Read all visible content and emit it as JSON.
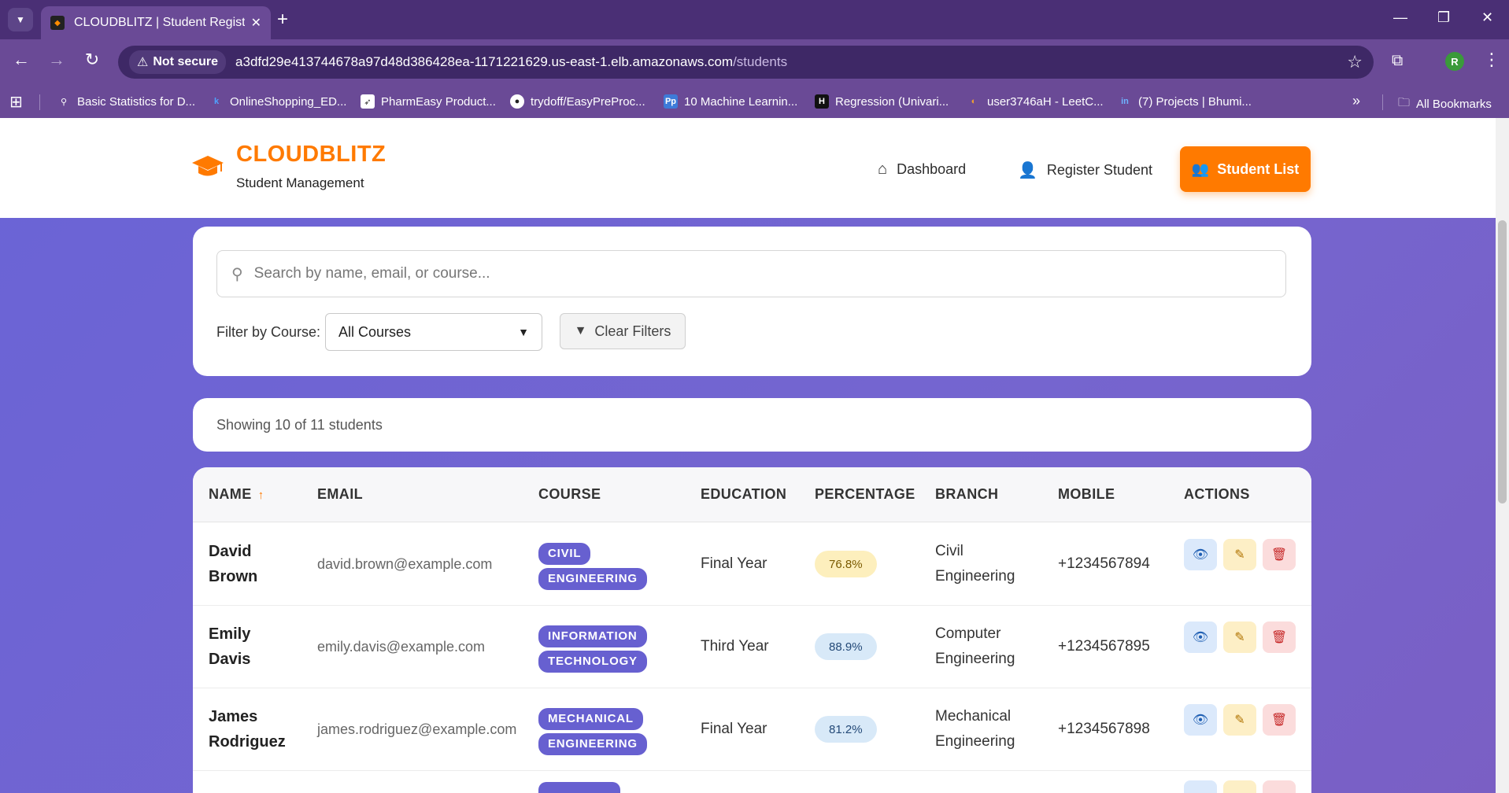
{
  "browser": {
    "tab_title": "CLOUDBLITZ | Student Registrat",
    "omnibox": {
      "security_label": "Not secure",
      "url_host": "a3dfd29e413744678a97d48d386428ea-1171221629.us-east-1.elb.amazonaws.com",
      "url_path": "/students"
    },
    "profile_initial": "R",
    "bookmarks": [
      "Basic Statistics for D...",
      "OnlineShopping_ED...",
      "PharmEasy Product...",
      "trydoff/EasyPreProc...",
      "10 Machine Learnin...",
      "Regression (Univari...",
      "user3746aH - LeetC...",
      "(7) Projects | Bhumi..."
    ],
    "all_bookmarks": "All Bookmarks"
  },
  "header": {
    "brand": "CLOUDBLITZ",
    "subtitle": "Student Management",
    "nav": {
      "dashboard": "Dashboard",
      "register": "Register Student",
      "list": "Student List"
    }
  },
  "filters": {
    "search_placeholder": "Search by name, email, or course...",
    "course_label": "Filter by Course:",
    "course_selected": "All Courses",
    "clear_label": "Clear Filters"
  },
  "summary": "Showing 10 of 11 students",
  "table": {
    "columns": [
      "NAME",
      "EMAIL",
      "COURSE",
      "EDUCATION",
      "PERCENTAGE",
      "BRANCH",
      "MOBILE",
      "ACTIONS"
    ],
    "sort_indicator": "↑",
    "rows": [
      {
        "name_first": "David",
        "name_last": "Brown",
        "email": "david.brown@example.com",
        "course_line1": "CIVIL",
        "course_line2": "ENGINEERING",
        "education": "Final Year",
        "percentage": "76.8%",
        "percentage_color": "#fdefbd",
        "branch_line1": "Civil",
        "branch_line2": "Engineering",
        "mobile": "+1234567894"
      },
      {
        "name_first": "Emily",
        "name_last": "Davis",
        "email": "emily.davis@example.com",
        "course_line1": "INFORMATION",
        "course_line2": "TECHNOLOGY",
        "education": "Third Year",
        "percentage": "88.9%",
        "percentage_color": "#d8e9f8",
        "branch_line1": "Computer",
        "branch_line2": "Engineering",
        "mobile": "+1234567895"
      },
      {
        "name_first": "James",
        "name_last": "Rodriguez",
        "email": "james.rodriguez@example.com",
        "course_line1": "MECHANICAL",
        "course_line2": "ENGINEERING",
        "education": "Final Year",
        "percentage": "81.2%",
        "percentage_color": "#d8e9f8",
        "branch_line1": "Mechanical",
        "branch_line2": "Engineering",
        "mobile": "+1234567898"
      }
    ]
  },
  "colors": {
    "accent": "#ff7a00",
    "badge": "#6760d0",
    "background": "#6a64d6"
  }
}
